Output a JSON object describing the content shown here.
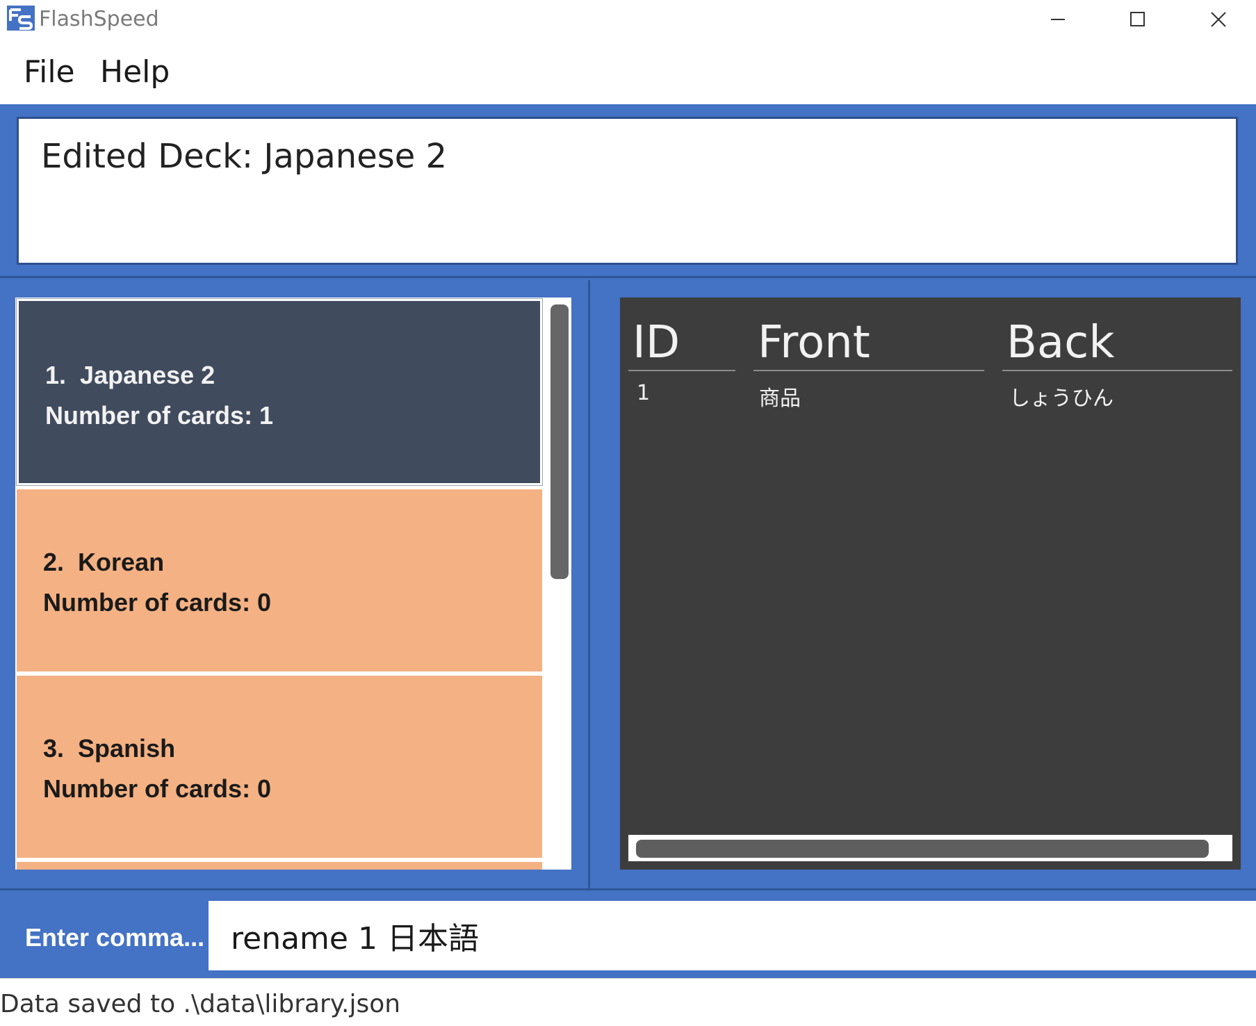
{
  "window": {
    "title": "FlashSpeed",
    "icon": "flashspeed-logo-icon",
    "controls": [
      "minimize-icon",
      "maximize-icon",
      "close-icon"
    ]
  },
  "menu": {
    "file": "File",
    "help": "Help"
  },
  "result": {
    "message": "Edited Deck: Japanese 2"
  },
  "decks": [
    {
      "index": "1.",
      "name": "Japanese 2",
      "count_label": "Number of cards: 1",
      "selected": true
    },
    {
      "index": "2.",
      "name": "Korean",
      "count_label": "Number of cards: 0",
      "selected": false
    },
    {
      "index": "3.",
      "name": "Spanish",
      "count_label": "Number of cards: 0",
      "selected": false
    }
  ],
  "card_table": {
    "columns": [
      "ID",
      "Front",
      "Back"
    ],
    "rows": [
      {
        "id": "1",
        "front": "商品",
        "back": "しょうひん"
      }
    ]
  },
  "command": {
    "label": "Enter comma...",
    "value": "rename 1 日本語"
  },
  "status": {
    "text": "Data saved to .\\data\\library.json"
  },
  "colors": {
    "accent_blue": "#4472c4",
    "selected_deck": "#414b5e",
    "deck_card": "#f4b183",
    "card_panel": "#3d3d3d"
  }
}
